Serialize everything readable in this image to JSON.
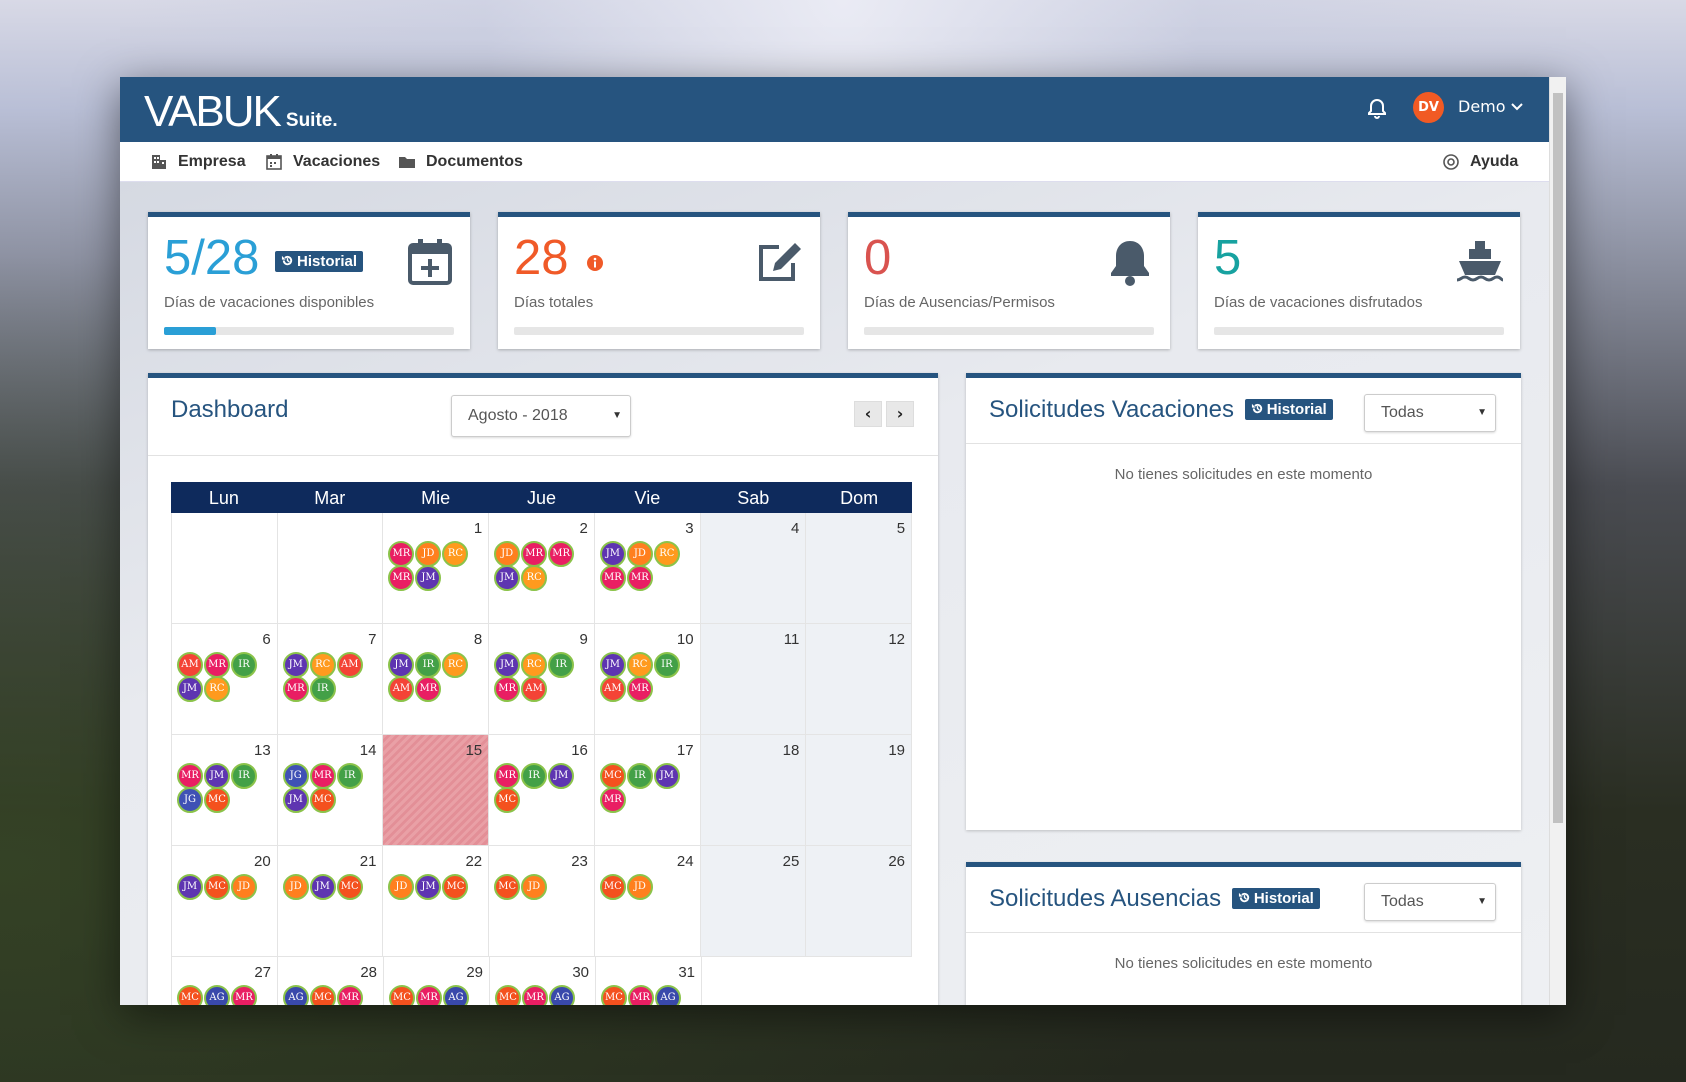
{
  "brand": {
    "logo": "VABUK",
    "suite": "Suite."
  },
  "header": {
    "avatar_initials": "DV",
    "user": "Demo"
  },
  "menu": {
    "empresa": "Empresa",
    "vacaciones": "Vacaciones",
    "documentos": "Documentos",
    "ayuda": "Ayuda"
  },
  "cards": [
    {
      "value": "5/28",
      "label": "Días de vacaciones disponibles",
      "history": "Historial",
      "progress": 0.18,
      "color": "#2a9fd6",
      "icon": "calendar-plus-icon"
    },
    {
      "value": "28",
      "label": "Días totales",
      "progress": 0,
      "color": "#e8532f",
      "icon": "edit-icon"
    },
    {
      "value": "0",
      "label": "Días de Ausencias/Permisos",
      "progress": 0,
      "color": "#d9534f",
      "icon": "bell-icon"
    },
    {
      "value": "5",
      "label": "Días de vacaciones disfrutados",
      "progress": 0,
      "color": "#17a2a0",
      "icon": "ship-icon"
    }
  ],
  "dashboard": {
    "title": "Dashboard",
    "month": "Agosto - 2018",
    "prev": "‹",
    "next": "›"
  },
  "weekdays": [
    "Lun",
    "Mar",
    "Mie",
    "Jue",
    "Vie",
    "Sab",
    "Dom"
  ],
  "calendar": [
    [
      {
        "d": ""
      },
      {
        "d": ""
      },
      {
        "d": "1",
        "p": [
          "MR",
          "JD",
          "RC",
          "MR",
          "JM"
        ]
      },
      {
        "d": "2",
        "p": [
          "JD",
          "MR",
          "MR",
          "JM",
          "RC"
        ]
      },
      {
        "d": "3",
        "p": [
          "JM",
          "JD",
          "RC",
          "MR",
          "MR"
        ]
      },
      {
        "d": "4",
        "we": true
      },
      {
        "d": "5",
        "we": true
      }
    ],
    [
      {
        "d": "6",
        "p": [
          "AM",
          "MR",
          "IR",
          "JM",
          "RC"
        ]
      },
      {
        "d": "7",
        "p": [
          "JM",
          "RC",
          "AM",
          "MR",
          "IR"
        ]
      },
      {
        "d": "8",
        "p": [
          "JM",
          "IR",
          "RC",
          "AM",
          "MR"
        ]
      },
      {
        "d": "9",
        "p": [
          "JM",
          "RC",
          "IR",
          "MR",
          "AM"
        ]
      },
      {
        "d": "10",
        "p": [
          "JM",
          "RC",
          "IR",
          "AM",
          "MR"
        ]
      },
      {
        "d": "11",
        "we": true
      },
      {
        "d": "12",
        "we": true
      }
    ],
    [
      {
        "d": "13",
        "p": [
          "MR",
          "JM",
          "IR",
          "JG",
          "MC"
        ]
      },
      {
        "d": "14",
        "p": [
          "JG",
          "MR",
          "IR",
          "JM",
          "MC"
        ]
      },
      {
        "d": "15",
        "today": true
      },
      {
        "d": "16",
        "p": [
          "MR",
          "IR",
          "JM",
          "MC"
        ]
      },
      {
        "d": "17",
        "p": [
          "MC",
          "IR",
          "JM",
          "MR"
        ]
      },
      {
        "d": "18",
        "we": true
      },
      {
        "d": "19",
        "we": true
      }
    ],
    [
      {
        "d": "20",
        "p": [
          "JM",
          "MC",
          "JD"
        ]
      },
      {
        "d": "21",
        "p": [
          "JD",
          "JM",
          "MC"
        ]
      },
      {
        "d": "22",
        "p": [
          "JD",
          "JM",
          "MC"
        ]
      },
      {
        "d": "23",
        "p": [
          "MC",
          "JD"
        ]
      },
      {
        "d": "24",
        "p": [
          "MC",
          "JD"
        ]
      },
      {
        "d": "25",
        "we": true
      },
      {
        "d": "26",
        "we": true
      }
    ],
    [
      {
        "d": "27",
        "p": [
          "MC",
          "AG",
          "MR"
        ]
      },
      {
        "d": "28",
        "p": [
          "AG",
          "MC",
          "MR"
        ]
      },
      {
        "d": "29",
        "p": [
          "MC",
          "MR",
          "AG"
        ]
      },
      {
        "d": "30",
        "p": [
          "MC",
          "MR",
          "AG"
        ]
      },
      {
        "d": "31",
        "p": [
          "MC",
          "MR",
          "AG"
        ]
      },
      {
        "d": "",
        "blank": true
      },
      {
        "d": "",
        "blank": true
      }
    ]
  ],
  "person_colors": {
    "MR": "#e91e63",
    "JD": "#ff7f1e",
    "RC": "#ff9a1e",
    "JM": "#5e35b1",
    "AM": "#f44336",
    "IR": "#43a047",
    "JG": "#3f51b5",
    "MC": "#f4511e",
    "AG": "#3949ab"
  },
  "vac_panel": {
    "title": "Solicitudes Vacaciones",
    "history": "Historial",
    "filter": "Todas",
    "empty": "No tienes solicitudes en este momento"
  },
  "aus_panel": {
    "title": "Solicitudes Ausencias",
    "history": "Historial",
    "filter": "Todas",
    "empty": "No tienes solicitudes en este momento"
  }
}
